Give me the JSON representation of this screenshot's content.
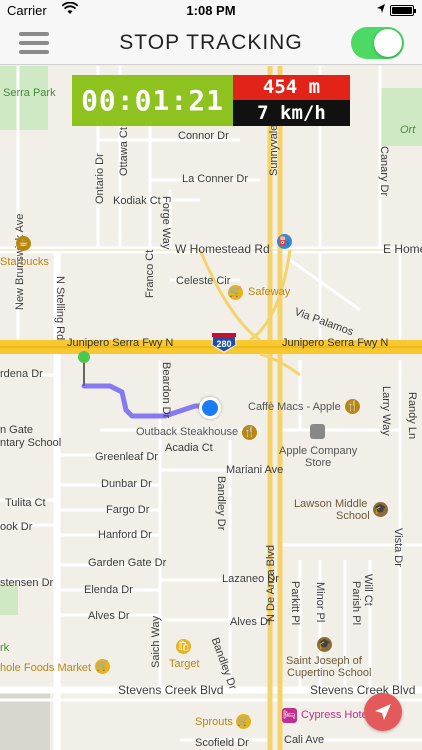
{
  "status_bar": {
    "carrier": "Carrier",
    "time": "1:08 PM"
  },
  "nav": {
    "title": "STOP TRACKING",
    "toggle_on": true
  },
  "tracker": {
    "elapsed": "00:01:21",
    "distance": "454 m",
    "speed": "7 km/h"
  },
  "map": {
    "streets": {
      "serra_park": "Serra Park",
      "new_brunswick": "New Brunswick Ave",
      "ottawa": "Ottawa Ct",
      "ontario": "Ontario Dr",
      "connor": "Connor Dr",
      "kodiak": "Kodiak Ct",
      "la_conner": "La Conner Dr",
      "forge": "Forge Way",
      "sunnyvale_saratoga": "Sunnyvale Saratoga",
      "canary": "Canary Dr",
      "starbucks": "Starbucks",
      "w_homestead": "W Homestead Rd",
      "e_home": "E Home",
      "safeway": "Safeway",
      "franco": "Franco Ct",
      "n_stelling": "N Stelling Rd",
      "celeste": "Celeste Cir",
      "via_palamos": "Via Palamos",
      "junipero_w": "Junipero Serra Fwy N",
      "i280": "280",
      "junipero_e": "Junipero Serra Fwy N",
      "ardena": "rdena Dr",
      "beardon": "Beardon Dr",
      "caffe": "Caffè Macs - Apple",
      "larry": "Larry Way",
      "randy": "Randy Ln",
      "outback": "Outback Steakhouse",
      "acadia": "Acadia Ct",
      "gate_school_1": "n Gate",
      "gate_school_2": "ntary School",
      "apple_store_1": "Apple Company",
      "apple_store_2": "Store",
      "greenleaf": "Greenleaf Dr",
      "mariani": "Mariani Ave",
      "dunbar": "Dunbar Dr",
      "n_de_anza": "N De Anza Blvd",
      "lawson_1": "Lawson Middle",
      "lawson_2": "School",
      "tulita": "Tulita Ct",
      "fargo": "Fargo Dr",
      "bandley": "Bandley Dr",
      "vista": "Vista Dr",
      "ook": "ook Dr",
      "hanford": "Hanford Dr",
      "garden_gate": "Garden Gate Dr",
      "lazaneo": "Lazaneo Dr",
      "stensen": "stensen Dr",
      "elenda": "Elenda Dr",
      "will": "Will Ct",
      "parish": "Parish Pl",
      "minor": "Minor Pl",
      "parkit": "Parkitt Pl",
      "alves_w": "Alves Dr",
      "alves_e": "Alves Dr",
      "saich": "Saich Way",
      "bandley2": "Bandley Dr",
      "target": "Target",
      "saint_joseph_1": "Saint Joseph of",
      "saint_joseph_2": "Cupertino School",
      "whole_foods": "hole Foods Market",
      "stevens_w": "Stevens Creek Blvd",
      "stevens_e": "Stevens Creek Blvd",
      "sprouts": "Sprouts",
      "cypress": "Cypress Hote",
      "scofield": "Scofield Dr",
      "cali": "Cali Ave",
      "rk": "rk",
      "ort": "Ort"
    }
  }
}
